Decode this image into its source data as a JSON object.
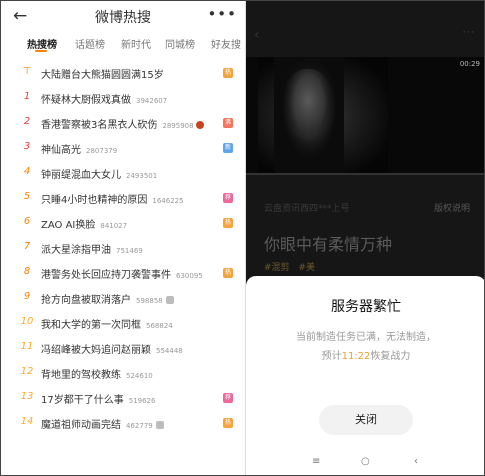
{
  "left": {
    "back_icon": "arrow-left-icon",
    "title": "微博热搜",
    "more_icon": "more-dots-icon",
    "more_glyph": "•••",
    "tabs": [
      {
        "label": "热搜榜"
      },
      {
        "label": "话题榜"
      },
      {
        "label": "新时代"
      },
      {
        "label": "同城榜"
      },
      {
        "label": "好友搜"
      }
    ],
    "rows": [
      {
        "rank": "",
        "title": "大陆赠台大熊猫圆圆满15岁",
        "count": "",
        "badge": "热",
        "badge_color": "#f7a33d",
        "pin": true
      },
      {
        "rank": "1",
        "title": "怀疑林大厨假戏真做",
        "count": "3942607",
        "badge": "",
        "badge_color": ""
      },
      {
        "rank": "2",
        "title": "香港警察被3名黑衣人砍伤",
        "count": "2895908",
        "badge": "沸",
        "badge_color": "#f5745e",
        "emoji": "dot"
      },
      {
        "rank": "3",
        "title": "神仙高光",
        "count": "2807379",
        "badge": "新",
        "badge_color": "#5ea4ef"
      },
      {
        "rank": "4",
        "title": "钟丽缇混血大女儿",
        "count": "2493501",
        "badge": "",
        "badge_color": ""
      },
      {
        "rank": "5",
        "title": "只睡4小时也精神的原因",
        "count": "1646225",
        "badge": "荐",
        "badge_color": "#f0679a"
      },
      {
        "rank": "6",
        "title": "ZAO AI换脸",
        "count": "841027",
        "badge": "热",
        "badge_color": "#f7a33d"
      },
      {
        "rank": "7",
        "title": "派大星涂指甲油",
        "count": "751469",
        "badge": "",
        "badge_color": ""
      },
      {
        "rank": "8",
        "title": "港警务处长回应持刀袭警事件",
        "count": "630095",
        "badge": "热",
        "badge_color": "#f7a33d"
      },
      {
        "rank": "9",
        "title": "抢方向盘被取消落户",
        "count": "598858",
        "badge": "",
        "badge_color": "",
        "emoji": "face"
      },
      {
        "rank": "10",
        "title": "我和大学的第一次同框",
        "count": "568824",
        "badge": "",
        "badge_color": ""
      },
      {
        "rank": "11",
        "title": "冯绍峰被大妈追问赵丽颖",
        "count": "554448",
        "badge": "",
        "badge_color": ""
      },
      {
        "rank": "12",
        "title": "背地里的驾校教练",
        "count": "524610",
        "badge": "",
        "badge_color": ""
      },
      {
        "rank": "13",
        "title": "17岁都干了什么事",
        "count": "519626",
        "badge": "荐",
        "badge_color": "#f0679a"
      },
      {
        "rank": "14",
        "title": "魔道祖师动画完结",
        "count": "462779",
        "badge": "热",
        "badge_color": "#f7a33d",
        "emoji": "face"
      }
    ]
  },
  "right": {
    "video_time": "00:29",
    "meta": "云盘资讯西四***上号",
    "copyright": "版权说明",
    "title": "你眼中有柔情万种",
    "tags": [
      "#混剪",
      "#美"
    ],
    "modal": {
      "title": "服务器繁忙",
      "message_line1": "当前制造任务已满，无法制造，",
      "message_line2_prefix": "预计",
      "message_line2_time": "11:22",
      "message_line2_suffix": "恢复战力",
      "close_label": "关闭"
    },
    "navbar": [
      {
        "label": "≡",
        "icon": "menu-icon"
      },
      {
        "label": "○",
        "icon": "home-icon"
      },
      {
        "label": "‹",
        "icon": "back-icon"
      }
    ]
  }
}
